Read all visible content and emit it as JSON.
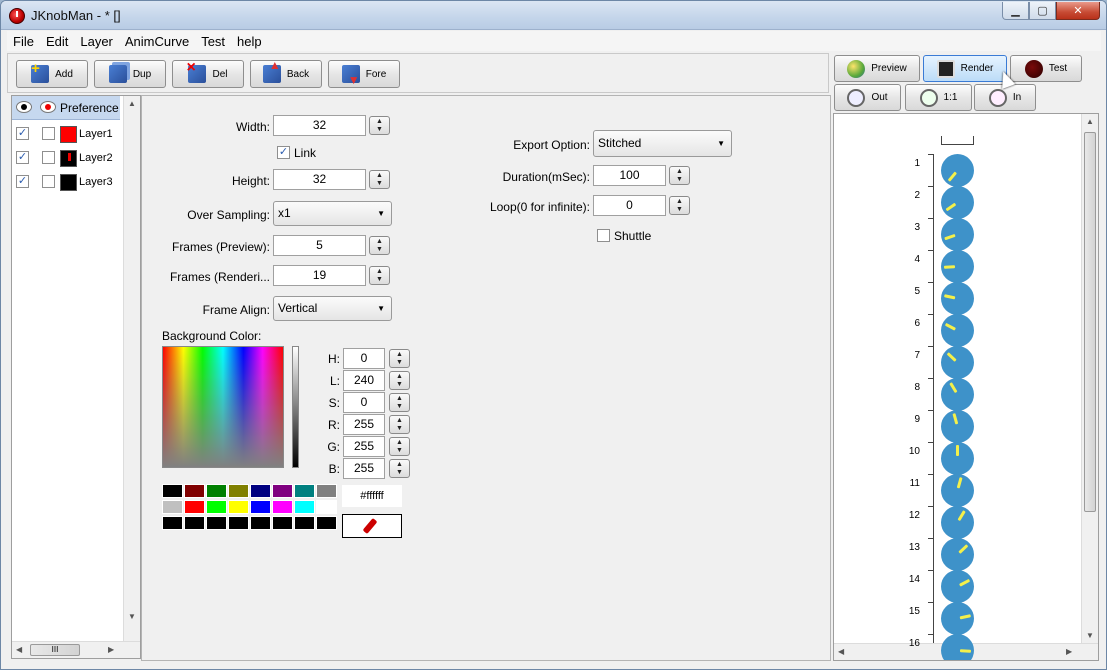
{
  "window": {
    "title": "JKnobMan - * []"
  },
  "menu": [
    "File",
    "Edit",
    "Layer",
    "AnimCurve",
    "Test",
    "help"
  ],
  "toolbar": {
    "add": "Add",
    "dup": "Dup",
    "del": "Del",
    "back": "Back",
    "fore": "Fore"
  },
  "layers": {
    "preference": "Preference",
    "items": [
      {
        "label": "Layer1",
        "visible": true,
        "solo": false,
        "color": "#ff0000"
      },
      {
        "label": "Layer2",
        "visible": true,
        "solo": false,
        "color": "#000000"
      },
      {
        "label": "Layer3",
        "visible": true,
        "solo": false,
        "color": "#000000"
      }
    ],
    "scroll_grip": "III"
  },
  "props": {
    "width_label": "Width:",
    "width": "32",
    "link_label": "Link",
    "height_label": "Height:",
    "height": "32",
    "oversampling_label": "Over Sampling:",
    "oversampling": "x1",
    "frames_preview_label": "Frames (Preview):",
    "frames_preview": "5",
    "frames_render_label": "Frames (Renderi...",
    "frames_render": "19",
    "frame_align_label": "Frame Align:",
    "frame_align": "Vertical",
    "bg_label": "Background Color:",
    "h_label": "H:",
    "h": "0",
    "l_label": "L:",
    "l": "240",
    "s_label": "S:",
    "s": "0",
    "r_label": "R:",
    "r": "255",
    "g_label": "G:",
    "g": "255",
    "b_label": "B:",
    "b": "255",
    "hex": "#ffffff",
    "export_label": "Export Option:",
    "export": "Stitched",
    "duration_label": "Duration(mSec):",
    "duration": "100",
    "loop_label": "Loop(0 for infinite):",
    "loop": "0",
    "shuttle_label": "Shuttle"
  },
  "palette": [
    "#000000",
    "#800000",
    "#008000",
    "#808000",
    "#000080",
    "#800080",
    "#008080",
    "#808080",
    "#c0c0c0",
    "#ff0000",
    "#00ff00",
    "#ffff00",
    "#0000ff",
    "#ff00ff",
    "#00ffff",
    "#ffffff",
    "#000000",
    "#000000",
    "#000000",
    "#000000",
    "#000000",
    "#000000",
    "#000000",
    "#000000"
  ],
  "preview": {
    "preview_btn": "Preview",
    "render_btn": "Render",
    "test_btn": "Test",
    "out_btn": "Out",
    "one_btn": "1:1",
    "in_btn": "In",
    "frames": [
      "1",
      "2",
      "3",
      "4",
      "5",
      "6",
      "7",
      "8",
      "9",
      "10",
      "11",
      "12",
      "13",
      "14",
      "15",
      "16"
    ]
  },
  "colors": {
    "knob": "#3e92c9",
    "indicator": "#f4f04a",
    "accent": "#3a7bd5"
  }
}
